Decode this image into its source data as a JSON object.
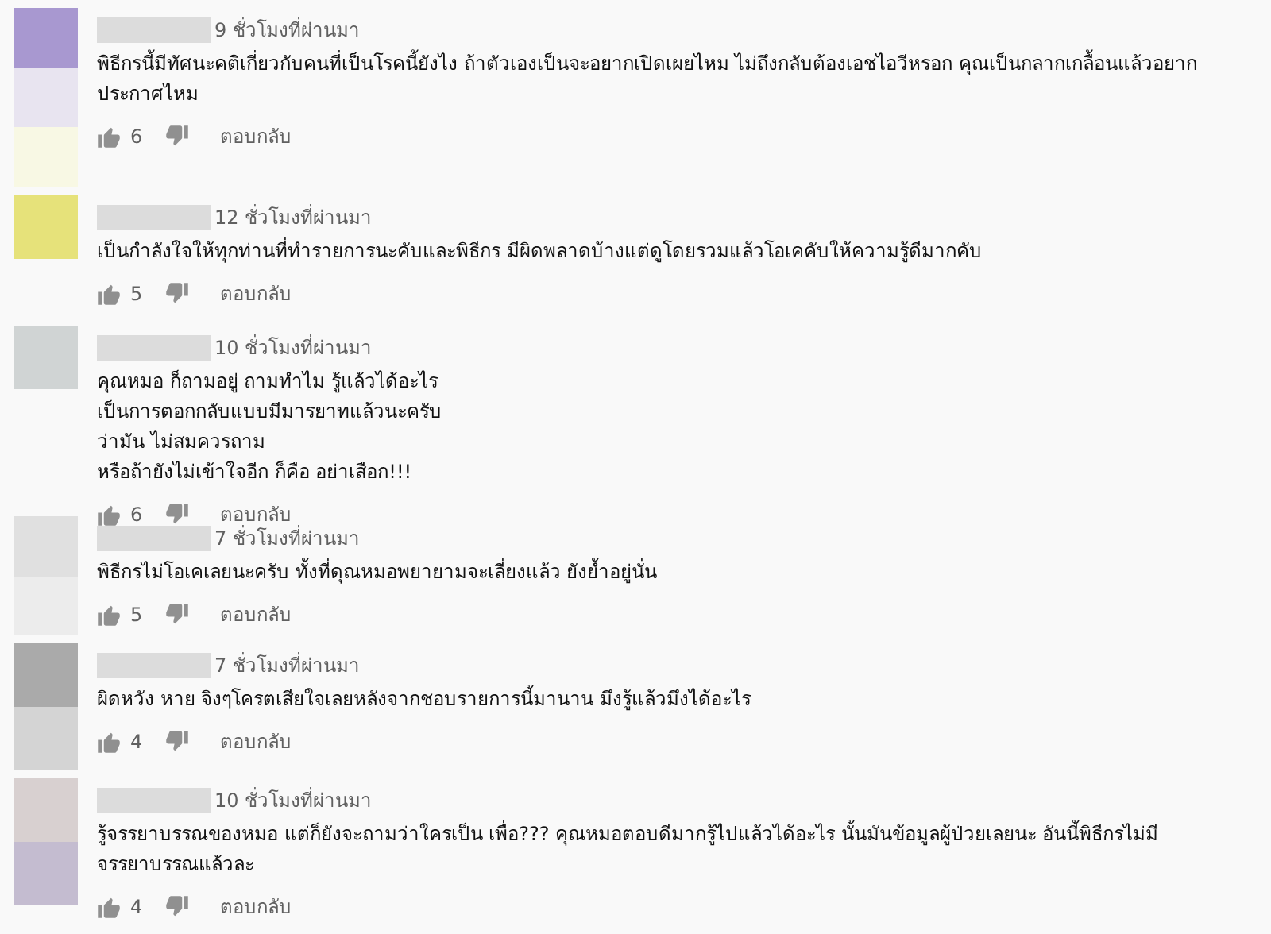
{
  "comments": [
    {
      "time": "9 ชั่วโมงที่ผ่านมา",
      "text": "พิธีกรนี้มีทัศนะคติเกี่ยวกับคนที่เป็นโรคนี้ยังไง ถ้าตัวเองเป็นจะอยากเปิดเผยไหม ไม่ถึงกลับต้องเอชไอวีหรอก คุณเป็นกลากเกลื้อนแล้วอยากประกาศไหม",
      "likes": "6",
      "reply": "ตอบกลับ",
      "avatar": [
        {
          "color": "#a898d0"
        },
        {
          "color": "#e8e4f0"
        },
        {
          "color": "#f8f8e4"
        }
      ]
    },
    {
      "time": "12 ชั่วโมงที่ผ่านมา",
      "text": "เป็นกำลังใจให้ทุกท่านที่ทำรายการนะคับและพิธีกร  มีผิดพลาดบ้างแต่ดูโดยรวมแล้วโอเคคับให้ความรู้ดีมากคับ",
      "likes": "5",
      "reply": "ตอบกลับ",
      "avatar": [
        {
          "color": "#e6e27a"
        }
      ]
    },
    {
      "time": "10 ชั่วโมงที่ผ่านมา",
      "text": "คุณหมอ ก็ถามอยู่  ถามทำไม รู้แล้วได้อะไร\nเป็นการตอกกลับแบบมีมารยาทแล้วนะครับ\nว่ามัน ไม่สมควรถาม\nหรือถ้ายังไม่เข้าใจอีก ก็คือ อย่าเสือก!!!",
      "likes": "6",
      "reply": "ตอบกลับ",
      "avatar": [
        {
          "color": "#d0d4d4"
        }
      ]
    },
    {
      "time": "7 ชั่วโมงที่ผ่านมา",
      "text": "พิธีกรไม่โอเคเลยนะครับ ทั้งที่ดุณหมอพยายามจะเลี่ยงแล้ว ยังย้ำอยู่นั่น",
      "likes": "5",
      "reply": "ตอบกลับ",
      "avatar": [
        {
          "color": "#e0e0e0"
        },
        {
          "color": "#ececec"
        }
      ]
    },
    {
      "time": "7 ชั่วโมงที่ผ่านมา",
      "text": "ผิดหวัง     หาย จิงๆโครตเสียใจเลยหลังจากชอบรายการนี้มานาน มึงรู้แล้วมึงได้อะไร",
      "likes": "4",
      "reply": "ตอบกลับ",
      "avatar": [
        {
          "color": "#aaaaaa"
        },
        {
          "color": "#d4d4d4"
        }
      ]
    },
    {
      "time": "10 ชั่วโมงที่ผ่านมา",
      "text": "รู้จรรยาบรรณของหมอ แต่ก็ยังจะถามว่าใครเป็น เพื่อ??? คุณหมอตอบดีมากรู้ไปแล้วได้อะไร นั้นมันข้อมูลผู้ป่วยเลยนะ อันนี้พิธีกรไม่มีจรรยาบรรณแล้วละ",
      "likes": "4",
      "reply": "ตอบกลับ",
      "avatar": [
        {
          "color": "#d8d0d0"
        },
        {
          "color": "#c4bcd0"
        }
      ]
    }
  ]
}
